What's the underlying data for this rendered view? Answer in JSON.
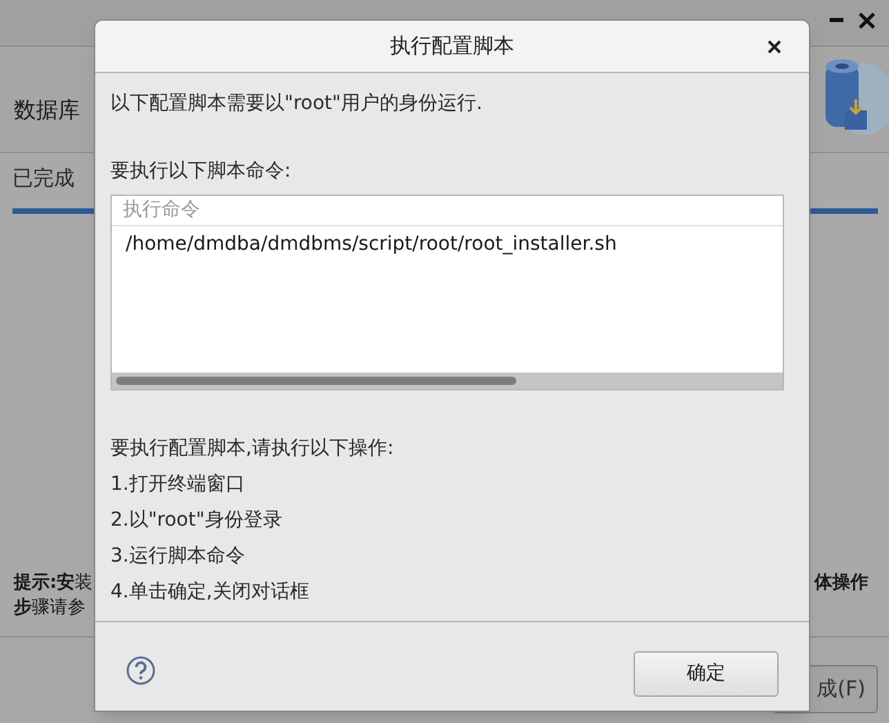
{
  "main_window": {
    "header": "数据库",
    "progress_label": "已完成",
    "progress": {
      "level": 1
    },
    "hint_lines": [
      "**提示:安**装",
      "**体操作**",
      "**步**骤请参"
    ],
    "finish_button": "成(F)"
  },
  "dialog": {
    "title": "执行配置脚本",
    "intro": "以下配置脚本需要以\"root\"用户的身份运行.",
    "commands_label": "要执行以下脚本命令:",
    "table": {
      "columns": [
        "执行命令"
      ],
      "rows": [
        [
          "/home/dmdba/dmdbms/script/root/root_installer.sh"
        ]
      ]
    },
    "steps_title": "要执行配置脚本,请执行以下操作:",
    "steps": [
      "1.打开终端窗口",
      "2.以\"root\"身份登录",
      "3.运行脚本命令",
      "4.单击确定,关闭对话框"
    ],
    "ok_button": "确定"
  }
}
